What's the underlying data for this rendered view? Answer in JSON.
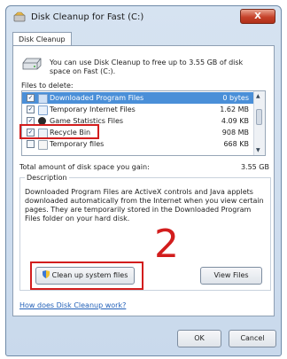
{
  "window": {
    "title": "Disk Cleanup for Fast (C:)",
    "close_label": "X"
  },
  "tabs": [
    {
      "label": "Disk Cleanup"
    }
  ],
  "intro": "You can use Disk Cleanup to free up to 3.55 GB of disk space on Fast (C:).",
  "files_to_delete_label": "Files to delete:",
  "file_list": [
    {
      "name": "Downloaded Program Files",
      "size": "0 bytes",
      "checked": true,
      "selected": true
    },
    {
      "name": "Temporary Internet Files",
      "size": "1.62 MB",
      "checked": true,
      "selected": false
    },
    {
      "name": "Game Statistics Files",
      "size": "4.09 KB",
      "checked": true,
      "selected": false
    },
    {
      "name": "Recycle Bin",
      "size": "908 MB",
      "checked": true,
      "selected": false
    },
    {
      "name": "Temporary files",
      "size": "668 KB",
      "checked": false,
      "selected": false
    }
  ],
  "total_label": "Total amount of disk space you gain:",
  "total_value": "3.55 GB",
  "description": {
    "legend": "Description",
    "text": "Downloaded Program Files are ActiveX controls and Java applets downloaded automatically from the Internet when you view certain pages. They are temporarily stored in the Downloaded Program Files folder on your hard disk."
  },
  "annotation_number": "2",
  "buttons": {
    "clean_system": "Clean up system files",
    "view_files": "View Files",
    "ok": "OK",
    "cancel": "Cancel"
  },
  "help_link": "How does Disk Cleanup work?",
  "colors": {
    "selection": "#4a8fd8",
    "highlight": "#d21d1d"
  }
}
